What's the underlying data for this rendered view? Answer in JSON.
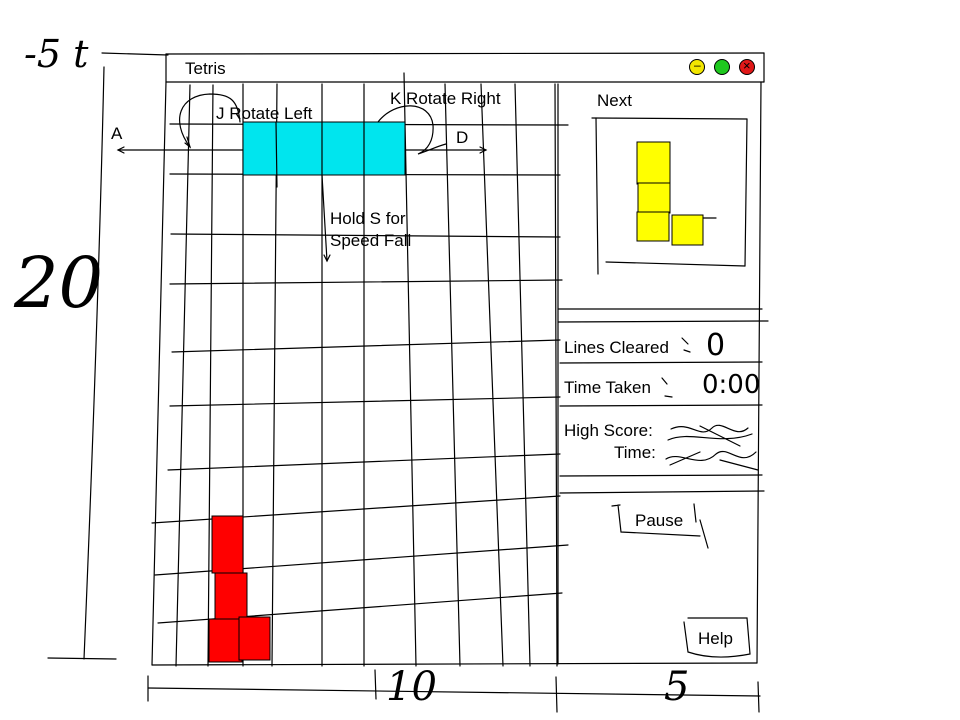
{
  "window": {
    "title": "Tetris",
    "buttons": [
      {
        "name": "minimize",
        "glyph": "–",
        "color": "#f2e600"
      },
      {
        "name": "maximize",
        "glyph": "",
        "color": "#1ec81e"
      },
      {
        "name": "close",
        "glyph": "×",
        "color": "#e01818"
      }
    ]
  },
  "annotations": {
    "top_left_count": "-5 t",
    "height_count": "20",
    "width_count": "10",
    "sidebar_width_count": "5"
  },
  "controls": {
    "left_key": "A",
    "right_key": "D",
    "rotate_left": "J Rotate Left",
    "rotate_right": "K Rotate Right",
    "speed_fall_line1": "Hold S for",
    "speed_fall_line2": "Speed Fall"
  },
  "sidebar": {
    "next_label": "Next",
    "lines_cleared_label": "Lines Cleared",
    "lines_cleared_value": "0",
    "time_taken_label": "Time Taken",
    "time_taken_value": "0:00",
    "high_score_label": "High Score:",
    "time_label": "Time:",
    "pause_label": "Pause",
    "help_label": "Help"
  },
  "colors": {
    "active_piece": "#00e5ee",
    "next_piece": "#ffff00",
    "landed_piece": "#ff0000"
  }
}
